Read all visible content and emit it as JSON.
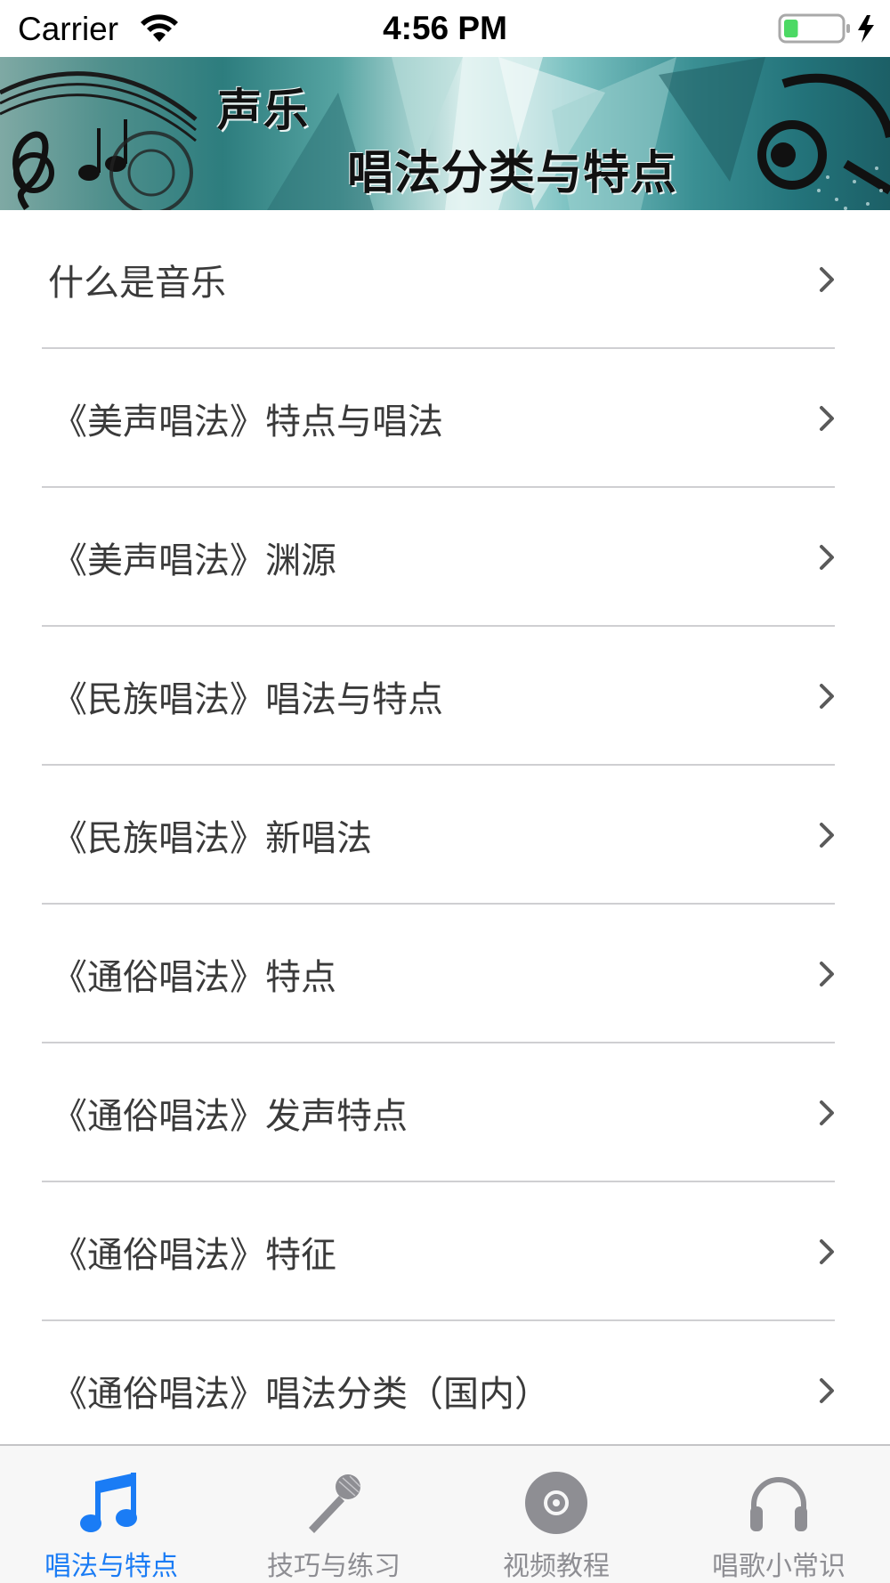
{
  "status_bar": {
    "carrier": "Carrier",
    "time": "4:56 PM",
    "battery_level": 0.25
  },
  "banner": {
    "title": "声乐",
    "subtitle": "唱法分类与特点"
  },
  "list": {
    "items": [
      {
        "label": "什么是音乐"
      },
      {
        "label": "《美声唱法》特点与唱法"
      },
      {
        "label": "《美声唱法》渊源"
      },
      {
        "label": "《民族唱法》唱法与特点"
      },
      {
        "label": "《民族唱法》新唱法"
      },
      {
        "label": "《通俗唱法》特点"
      },
      {
        "label": "《通俗唱法》发声特点"
      },
      {
        "label": "《通俗唱法》特征"
      },
      {
        "label": "《通俗唱法》唱法分类（国内）"
      }
    ]
  },
  "tab_bar": {
    "tabs": [
      {
        "label": "唱法与特点",
        "icon": "music-note-icon",
        "active": true
      },
      {
        "label": "技巧与练习",
        "icon": "microphone-icon",
        "active": false
      },
      {
        "label": "视频教程",
        "icon": "disc-icon",
        "active": false
      },
      {
        "label": "唱歌小常识",
        "icon": "headphones-icon",
        "active": false
      }
    ]
  },
  "colors": {
    "accent": "#1a7cf5",
    "inactive": "#8e8e93",
    "text": "#3a3a3a",
    "battery_fill": "#4cd964"
  }
}
